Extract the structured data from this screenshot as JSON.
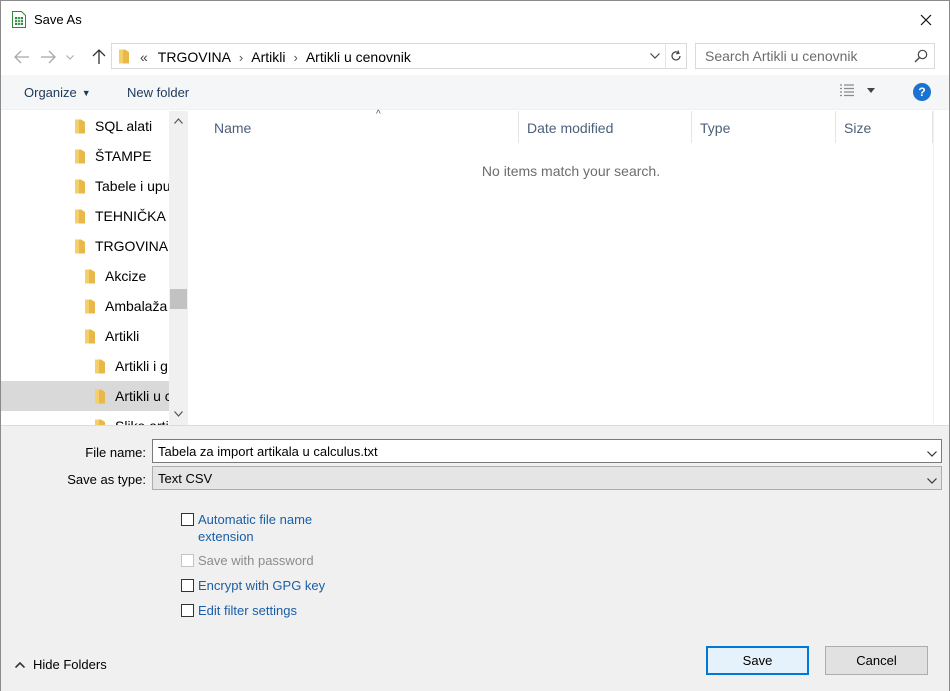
{
  "window": {
    "title": "Save As"
  },
  "address": {
    "overflow": "«",
    "crumbs": [
      "TRGOVINA",
      "Artikli",
      "Artikli u cenovnik"
    ]
  },
  "search": {
    "placeholder": "Search Artikli u cenovnik"
  },
  "commands": {
    "organize": "Organize",
    "new_folder": "New folder",
    "help": "?"
  },
  "tree": [
    {
      "label": "SQL alati",
      "depth": 0
    },
    {
      "label": "ŠTAMPE",
      "depth": 0
    },
    {
      "label": "Tabele i uput",
      "depth": 0
    },
    {
      "label": "TEHNIČKA P",
      "depth": 0
    },
    {
      "label": "TRGOVINA",
      "depth": 0
    },
    {
      "label": "Akcize",
      "depth": 1
    },
    {
      "label": "Ambalaža",
      "depth": 1
    },
    {
      "label": "Artikli",
      "depth": 1
    },
    {
      "label": "Artikli i g",
      "depth": 2
    },
    {
      "label": "Artikli u c",
      "depth": 2,
      "selected": true
    },
    {
      "label": "Slike artikl",
      "depth": 2
    }
  ],
  "columns": [
    "Name",
    "Date modified",
    "Type",
    "Size"
  ],
  "file_list": {
    "empty_message": "No items match your search."
  },
  "form": {
    "file_name_label": "File name:",
    "file_name_value": "Tabela za import artikala u calculus.txt",
    "save_type_label": "Save as type:",
    "save_type_value": "Text CSV"
  },
  "options": [
    {
      "label_line1": "Automatic file name",
      "label_line2": "extension",
      "checked": false,
      "enabled": true
    },
    {
      "label_line1": "Save with password",
      "checked": false,
      "enabled": false
    },
    {
      "label_line1": "Encrypt with GPG key",
      "checked": false,
      "enabled": true
    },
    {
      "label_line1": "Edit filter settings",
      "checked": false,
      "enabled": true
    }
  ],
  "footer": {
    "hide_folders": "Hide Folders",
    "save": "Save",
    "cancel": "Cancel"
  },
  "colors": {
    "accent": "#0078d7",
    "link": "#1a5ea8",
    "folder": "#e8b84a",
    "selected_row": "#d9d9d9"
  }
}
